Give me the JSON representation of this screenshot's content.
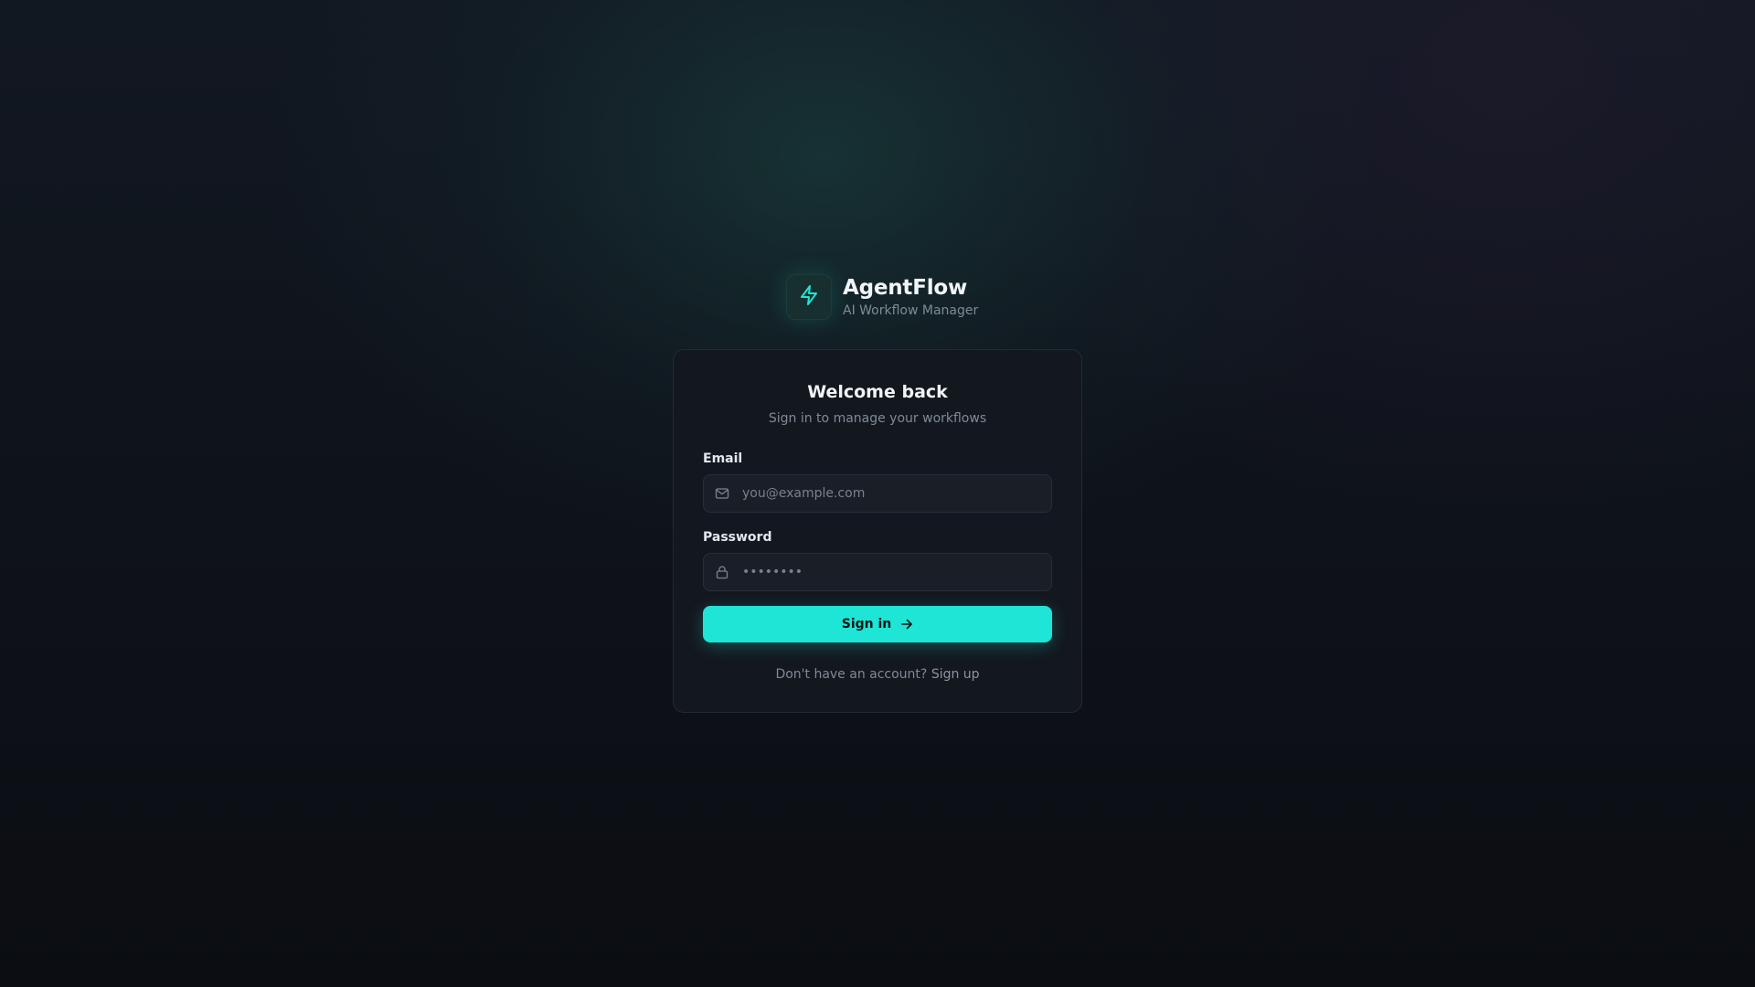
{
  "brand": {
    "name": "AgentFlow",
    "tagline": "AI Workflow Manager",
    "icon": "lightning-bolt-icon",
    "accent_color": "#1ee5d5"
  },
  "login": {
    "title": "Welcome back",
    "subtitle": "Sign in to manage your workflows",
    "email": {
      "label": "Email",
      "placeholder": "you@example.com",
      "value": "",
      "icon": "mail-icon"
    },
    "password": {
      "label": "Password",
      "placeholder": "••••••••",
      "value": "",
      "icon": "lock-icon"
    },
    "submit": {
      "label": "Sign in",
      "icon": "arrow-right-icon"
    },
    "footer": {
      "prompt": "Don't have an account?",
      "link_label": "Sign up"
    }
  }
}
